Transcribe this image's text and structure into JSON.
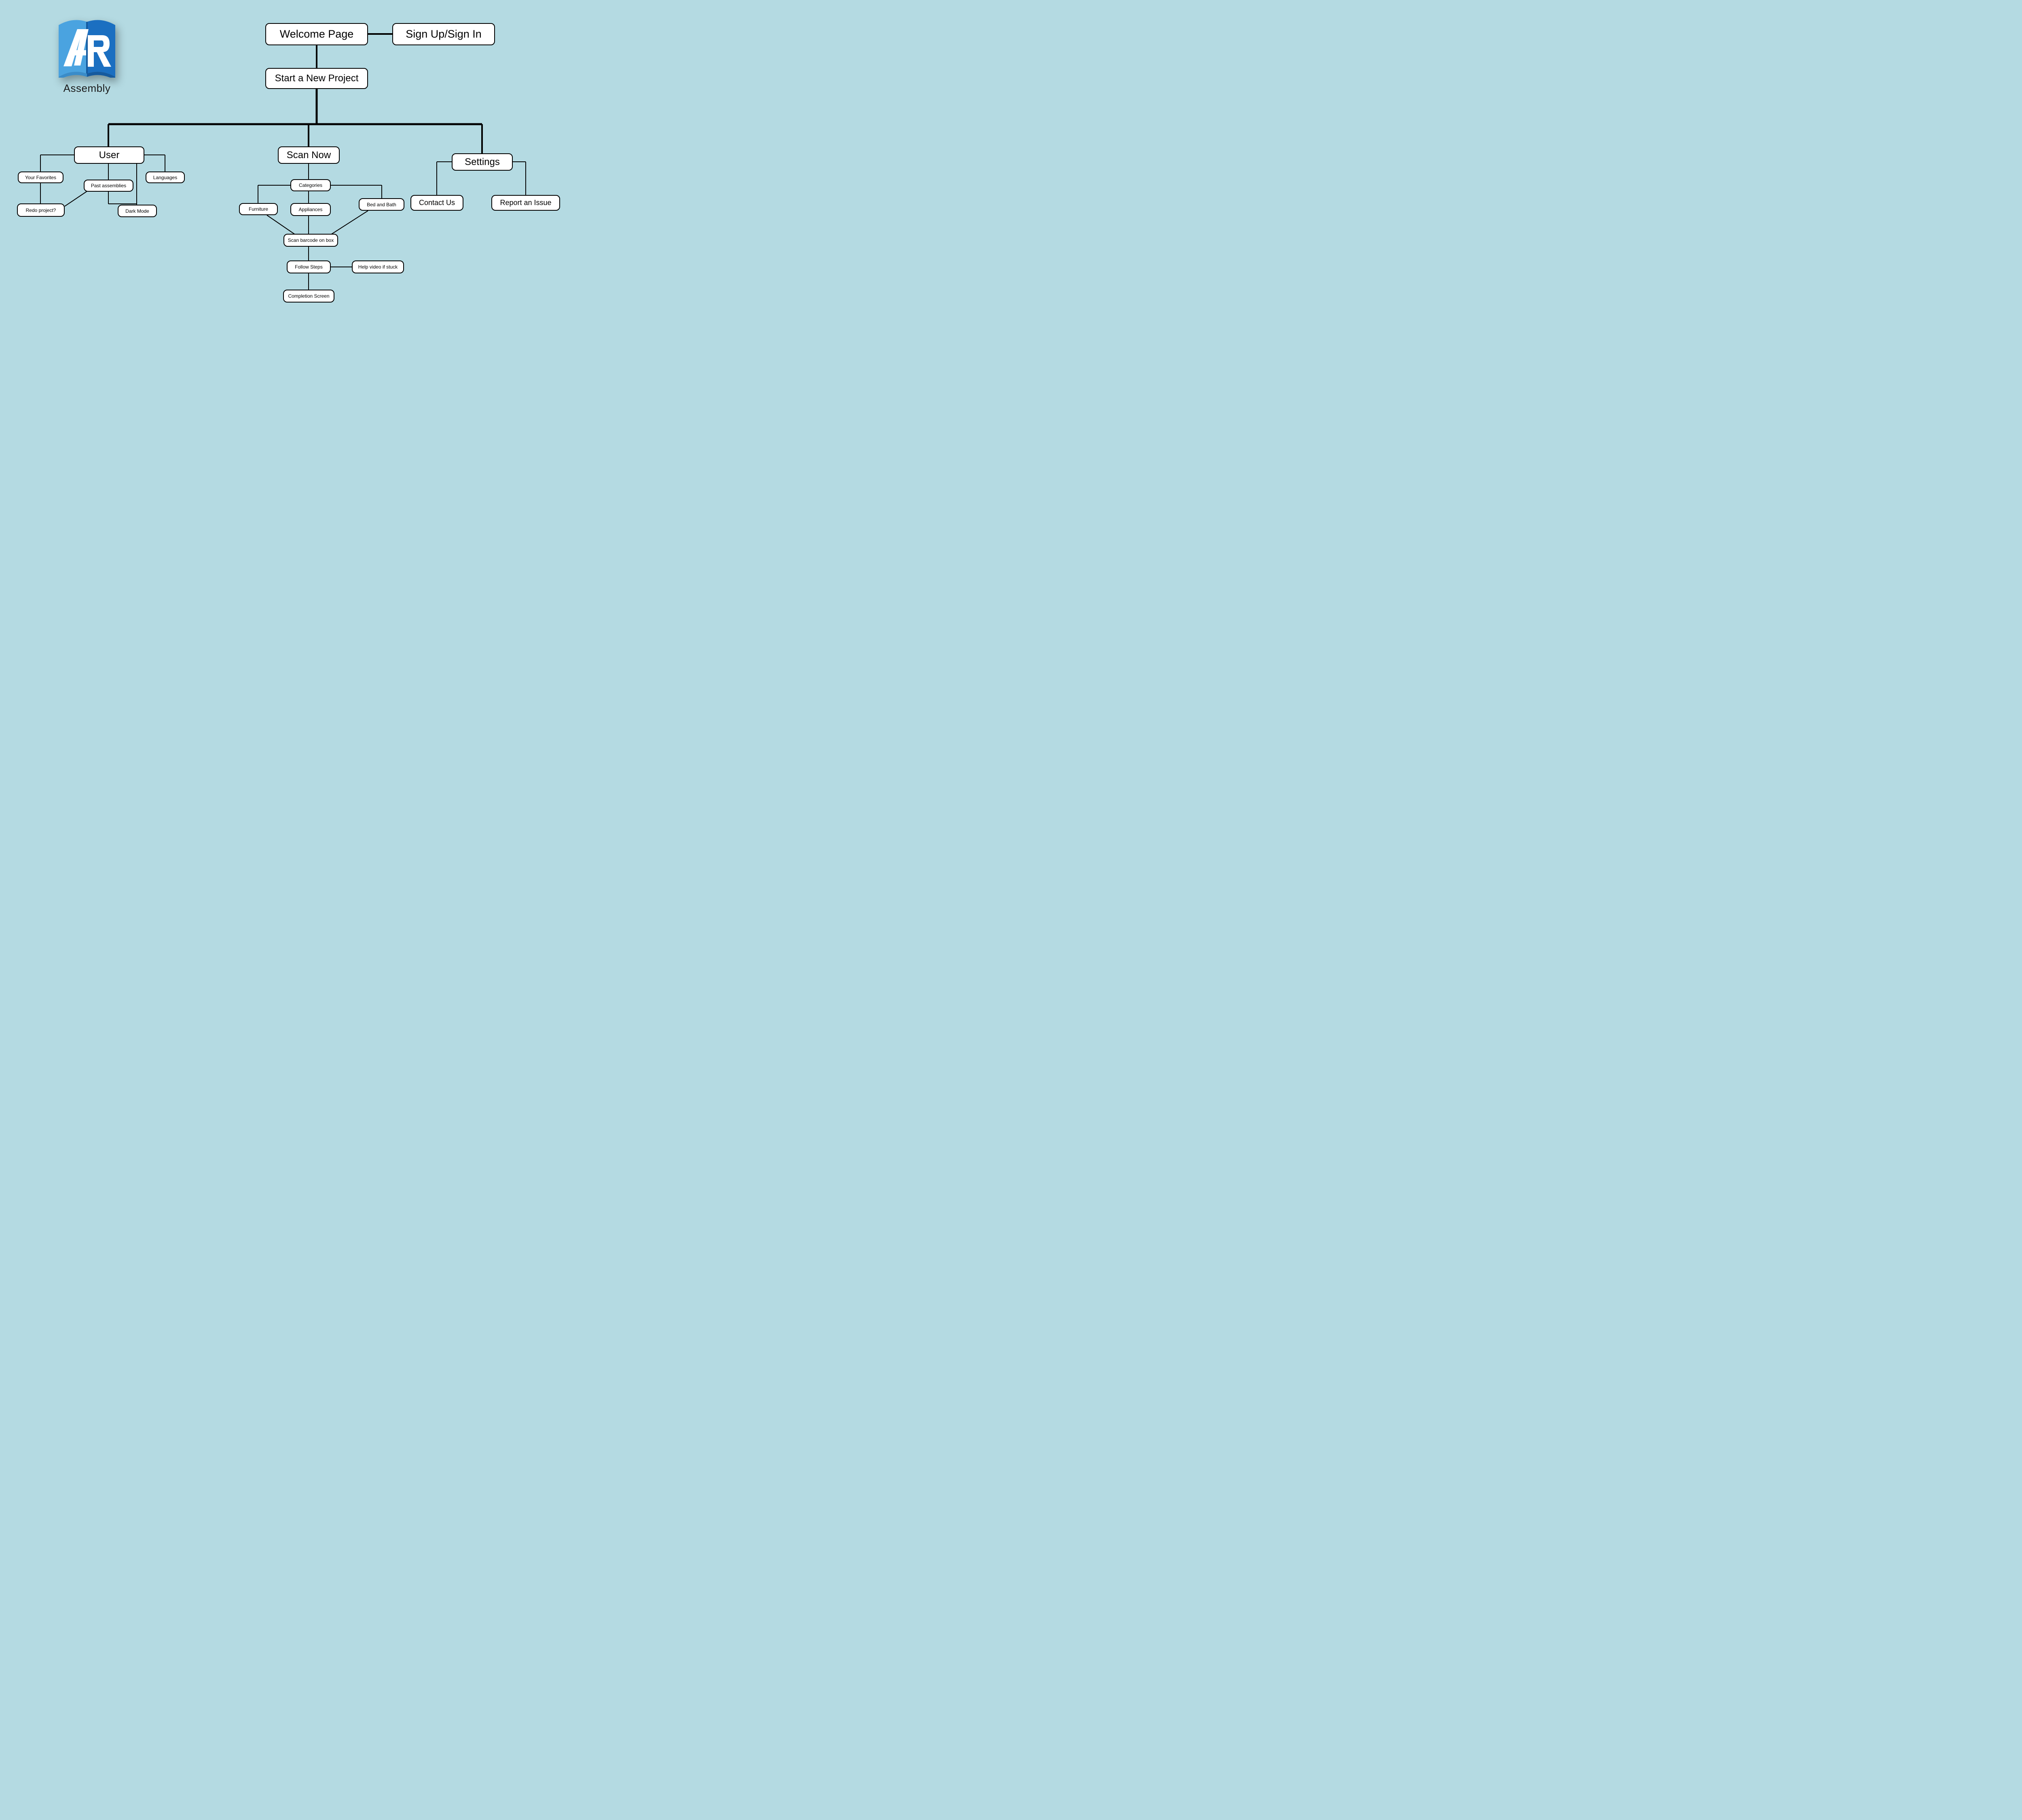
{
  "brand": {
    "name": "Assembly"
  },
  "nodes": {
    "welcome": "Welcome Page",
    "signup": "Sign Up/Sign In",
    "start": "Start a New Project",
    "user": "User",
    "scan": "Scan Now",
    "settings": "Settings",
    "favorites": "Your Favorites",
    "past": "Past assemblies",
    "languages": "Languages",
    "redo": "Redo project?",
    "dark": "Dark Mode",
    "categories": "Categories",
    "furniture": "Furniture",
    "appliances": "Appliances",
    "bedbath": "Bed and Bath",
    "scanbarcode": "Scan barcode on box",
    "followsteps": "Follow Steps",
    "helpvideo": "Help video if stuck",
    "completion": "Completion Screen",
    "contact": "Contact Us",
    "report": "Report an Issue"
  }
}
